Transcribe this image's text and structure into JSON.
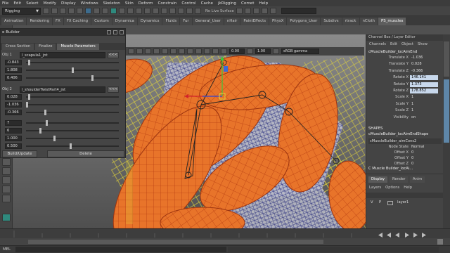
{
  "menubar": [
    "File",
    "Edit",
    "Select",
    "Modify",
    "Display",
    "Windows",
    "Skeleton",
    "Skin",
    "Deform",
    "Constrain",
    "Control",
    "Cache",
    "jkRigging",
    "Comet",
    "Help"
  ],
  "status": {
    "mode": "Rigging",
    "live_surface": "No Live Surface"
  },
  "shelf_tabs": [
    "Animation",
    "Rendering",
    "FX",
    "FX Caching",
    "Custom",
    "Dynamica",
    "Dynamics",
    "Fluids",
    "Fur",
    "General_User",
    "nHair",
    "PaintEffects",
    "PhysX",
    "Polygons_User",
    "Subdivs",
    "rtrack",
    "nCloth",
    "PS_muscles"
  ],
  "shelf_active": "PS_muscles",
  "viewport_toolbar": {
    "field1": "0.00",
    "field2": "1.00",
    "colorspace": "sRGB gamma"
  },
  "muscle_builder": {
    "title": "e Builder",
    "tabs": [
      "Cross Section",
      "Finalize",
      "Muscle Parameters"
    ],
    "active_tab": "Muscle Parameters",
    "obj1": {
      "label": "Obj 1",
      "value": "l_scapula1_jnt",
      "button": "<<<",
      "fields": [
        {
          "value": "-0.843",
          "level": 0.02
        },
        {
          "value": "1.808",
          "level": 0.5
        },
        {
          "value": "0.406",
          "level": 0.72
        }
      ]
    },
    "obj2": {
      "label": "Obj 2",
      "value": "l_shoulderTwistPart4_jnt",
      "button": "<<<",
      "fields": [
        {
          "value": "0.028",
          "level": 0.02
        },
        {
          "value": "-1.036",
          "level": 0.0
        },
        {
          "value": "-0.366",
          "level": 0.2
        },
        {
          "value": "7",
          "level": 0.22
        },
        {
          "value": "6",
          "level": 0.15
        },
        {
          "value": "1.000",
          "level": 0.3
        },
        {
          "value": "0.500",
          "level": 0.48
        }
      ]
    },
    "buttons": {
      "build": "Build/Update",
      "delete": "Delete"
    }
  },
  "channel_box": {
    "header": "Channel Box / Layer Editor",
    "menus": [
      "Channels",
      "Edit",
      "Object",
      "Show"
    ],
    "object_name": "cMuscleBuilder_locAimEnd",
    "attributes": [
      {
        "label": "Translate X",
        "value": "-1.036",
        "highlight": false
      },
      {
        "label": "Translate Y",
        "value": "0.028",
        "highlight": false
      },
      {
        "label": "Translate Z",
        "value": "-0.366",
        "highlight": false
      },
      {
        "label": "Rotate X",
        "value": "146.141",
        "highlight": true
      },
      {
        "label": "Rotate Y",
        "value": "1.373",
        "highlight": true
      },
      {
        "label": "Rotate Z",
        "value": "178.852",
        "highlight": true
      },
      {
        "label": "Scale X",
        "value": "1",
        "highlight": false
      },
      {
        "label": "Scale Y",
        "value": "1",
        "highlight": false
      },
      {
        "label": "Scale Z",
        "value": "1",
        "highlight": false
      },
      {
        "label": "Visibility",
        "value": "on",
        "highlight": false
      }
    ],
    "shapes_title": "SHAPES",
    "shape_name": "cMuscleBuilder_locAimEndShape",
    "inputs_title": "cMuscleBuilder_aimCons2",
    "input_attrs": [
      {
        "label": "Node State",
        "value": "Normal"
      },
      {
        "label": "Offset X",
        "value": "0"
      },
      {
        "label": "Offset Y",
        "value": "0"
      },
      {
        "label": "Offset Z",
        "value": "0"
      }
    ],
    "last_line": "C Muscle Builder_locAi...",
    "side_tabs": [
      "Attribute Editor",
      "Channel Box / Layer Editor"
    ]
  },
  "layer_editor": {
    "tabs": [
      "Display",
      "Render",
      "Anim"
    ],
    "active_tab": "Display",
    "menus": [
      "Layers",
      "Options",
      "Help"
    ],
    "layer": {
      "v": "V",
      "p": "P",
      "name": "layer1"
    }
  },
  "command_line": {
    "label": "MEL"
  },
  "colors": {
    "muscle_orange": "#e8742a",
    "muscle_line": "#b53a10",
    "joint_yellow": "#e2d43a",
    "mesh_wire": "#3a3f8c",
    "highlight": "#c8d8ec"
  }
}
